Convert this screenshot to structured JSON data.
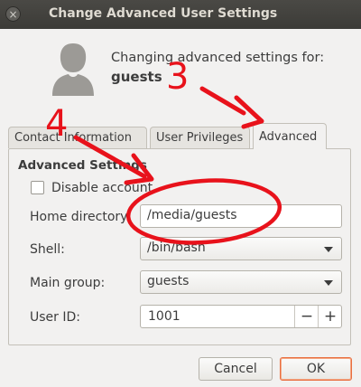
{
  "window": {
    "title": "Change Advanced User Settings",
    "close_glyph": "×"
  },
  "header": {
    "line1": "Changing advanced settings for:",
    "username": "guests"
  },
  "tabs": [
    {
      "label": "Contact Information",
      "active": false
    },
    {
      "label": "User Privileges",
      "active": false
    },
    {
      "label": "Advanced",
      "active": true
    }
  ],
  "advanced": {
    "section_title": "Advanced Settings",
    "disable_account_label": "Disable account",
    "disable_account_checked": false,
    "home_directory_label": "Home directory:",
    "home_directory_value": "/media/guests",
    "shell_label": "Shell:",
    "shell_value": "/bin/bash",
    "main_group_label": "Main group:",
    "main_group_value": "guests",
    "user_id_label": "User ID:",
    "user_id_value": "1001",
    "minus_glyph": "−",
    "plus_glyph": "+"
  },
  "buttons": {
    "cancel": "Cancel",
    "ok": "OK"
  },
  "annotations": {
    "step3": "3",
    "step4": "4",
    "color": "#e8121b"
  },
  "colors": {
    "titlebar": "#3c3b37",
    "ok_border": "#e96e3f"
  }
}
